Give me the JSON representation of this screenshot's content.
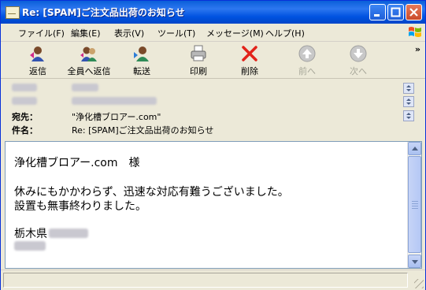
{
  "window": {
    "title": "Re: [SPAM]ご注文品出荷のお知らせ"
  },
  "menu": [
    "ファイル(F)",
    "編集(E)",
    "表示(V)",
    "ツール(T)",
    "メッセージ(M)",
    "ヘルプ(H)"
  ],
  "toolbar": [
    {
      "label": "返信",
      "icon": "reply-icon",
      "enabled": true
    },
    {
      "label": "全員へ返信",
      "icon": "reply-all-icon",
      "enabled": true
    },
    {
      "label": "転送",
      "icon": "forward-icon",
      "enabled": true
    },
    {
      "label": "印刷",
      "icon": "printer-icon",
      "enabled": true
    },
    {
      "label": "削除",
      "icon": "delete-icon",
      "enabled": true
    },
    {
      "label": "前へ",
      "icon": "previous-icon",
      "enabled": false
    },
    {
      "label": "次へ",
      "icon": "next-icon",
      "enabled": false
    }
  ],
  "header": {
    "to_label": "宛先：",
    "to_value": "\"浄化槽ブロアー.com\"",
    "subject_label": "件名：",
    "subject_value": "Re: [SPAM]ご注文品出荷のお知らせ"
  },
  "message": {
    "line1": "浄化槽ブロアー.com　様",
    "line2": "休みにもかかわらず、迅速な対応有難うございました。",
    "line3": "設置も無事終わりました。",
    "line4": "栃木県"
  },
  "colors": {
    "title_bar": "#0054e3",
    "close_button": "#d8573a",
    "accent": "#316ac5"
  }
}
